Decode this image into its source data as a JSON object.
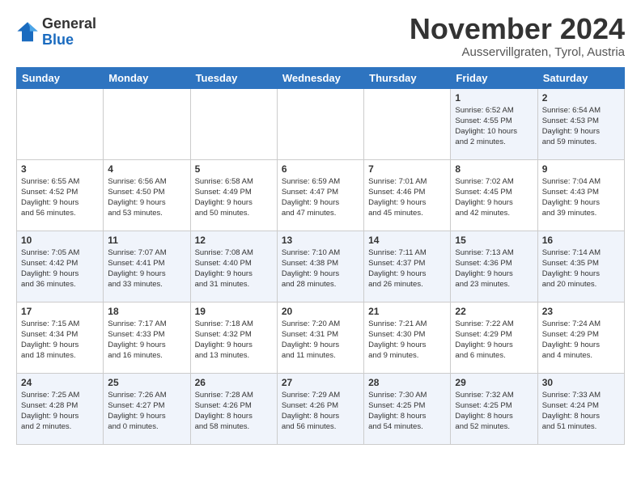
{
  "header": {
    "logo_general": "General",
    "logo_blue": "Blue",
    "month_title": "November 2024",
    "location": "Ausservillgraten, Tyrol, Austria"
  },
  "weekdays": [
    "Sunday",
    "Monday",
    "Tuesday",
    "Wednesday",
    "Thursday",
    "Friday",
    "Saturday"
  ],
  "weeks": [
    [
      {
        "day": "",
        "info": ""
      },
      {
        "day": "",
        "info": ""
      },
      {
        "day": "",
        "info": ""
      },
      {
        "day": "",
        "info": ""
      },
      {
        "day": "",
        "info": ""
      },
      {
        "day": "1",
        "info": "Sunrise: 6:52 AM\nSunset: 4:55 PM\nDaylight: 10 hours\nand 2 minutes."
      },
      {
        "day": "2",
        "info": "Sunrise: 6:54 AM\nSunset: 4:53 PM\nDaylight: 9 hours\nand 59 minutes."
      }
    ],
    [
      {
        "day": "3",
        "info": "Sunrise: 6:55 AM\nSunset: 4:52 PM\nDaylight: 9 hours\nand 56 minutes."
      },
      {
        "day": "4",
        "info": "Sunrise: 6:56 AM\nSunset: 4:50 PM\nDaylight: 9 hours\nand 53 minutes."
      },
      {
        "day": "5",
        "info": "Sunrise: 6:58 AM\nSunset: 4:49 PM\nDaylight: 9 hours\nand 50 minutes."
      },
      {
        "day": "6",
        "info": "Sunrise: 6:59 AM\nSunset: 4:47 PM\nDaylight: 9 hours\nand 47 minutes."
      },
      {
        "day": "7",
        "info": "Sunrise: 7:01 AM\nSunset: 4:46 PM\nDaylight: 9 hours\nand 45 minutes."
      },
      {
        "day": "8",
        "info": "Sunrise: 7:02 AM\nSunset: 4:45 PM\nDaylight: 9 hours\nand 42 minutes."
      },
      {
        "day": "9",
        "info": "Sunrise: 7:04 AM\nSunset: 4:43 PM\nDaylight: 9 hours\nand 39 minutes."
      }
    ],
    [
      {
        "day": "10",
        "info": "Sunrise: 7:05 AM\nSunset: 4:42 PM\nDaylight: 9 hours\nand 36 minutes."
      },
      {
        "day": "11",
        "info": "Sunrise: 7:07 AM\nSunset: 4:41 PM\nDaylight: 9 hours\nand 33 minutes."
      },
      {
        "day": "12",
        "info": "Sunrise: 7:08 AM\nSunset: 4:40 PM\nDaylight: 9 hours\nand 31 minutes."
      },
      {
        "day": "13",
        "info": "Sunrise: 7:10 AM\nSunset: 4:38 PM\nDaylight: 9 hours\nand 28 minutes."
      },
      {
        "day": "14",
        "info": "Sunrise: 7:11 AM\nSunset: 4:37 PM\nDaylight: 9 hours\nand 26 minutes."
      },
      {
        "day": "15",
        "info": "Sunrise: 7:13 AM\nSunset: 4:36 PM\nDaylight: 9 hours\nand 23 minutes."
      },
      {
        "day": "16",
        "info": "Sunrise: 7:14 AM\nSunset: 4:35 PM\nDaylight: 9 hours\nand 20 minutes."
      }
    ],
    [
      {
        "day": "17",
        "info": "Sunrise: 7:15 AM\nSunset: 4:34 PM\nDaylight: 9 hours\nand 18 minutes."
      },
      {
        "day": "18",
        "info": "Sunrise: 7:17 AM\nSunset: 4:33 PM\nDaylight: 9 hours\nand 16 minutes."
      },
      {
        "day": "19",
        "info": "Sunrise: 7:18 AM\nSunset: 4:32 PM\nDaylight: 9 hours\nand 13 minutes."
      },
      {
        "day": "20",
        "info": "Sunrise: 7:20 AM\nSunset: 4:31 PM\nDaylight: 9 hours\nand 11 minutes."
      },
      {
        "day": "21",
        "info": "Sunrise: 7:21 AM\nSunset: 4:30 PM\nDaylight: 9 hours\nand 9 minutes."
      },
      {
        "day": "22",
        "info": "Sunrise: 7:22 AM\nSunset: 4:29 PM\nDaylight: 9 hours\nand 6 minutes."
      },
      {
        "day": "23",
        "info": "Sunrise: 7:24 AM\nSunset: 4:29 PM\nDaylight: 9 hours\nand 4 minutes."
      }
    ],
    [
      {
        "day": "24",
        "info": "Sunrise: 7:25 AM\nSunset: 4:28 PM\nDaylight: 9 hours\nand 2 minutes."
      },
      {
        "day": "25",
        "info": "Sunrise: 7:26 AM\nSunset: 4:27 PM\nDaylight: 9 hours\nand 0 minutes."
      },
      {
        "day": "26",
        "info": "Sunrise: 7:28 AM\nSunset: 4:26 PM\nDaylight: 8 hours\nand 58 minutes."
      },
      {
        "day": "27",
        "info": "Sunrise: 7:29 AM\nSunset: 4:26 PM\nDaylight: 8 hours\nand 56 minutes."
      },
      {
        "day": "28",
        "info": "Sunrise: 7:30 AM\nSunset: 4:25 PM\nDaylight: 8 hours\nand 54 minutes."
      },
      {
        "day": "29",
        "info": "Sunrise: 7:32 AM\nSunset: 4:25 PM\nDaylight: 8 hours\nand 52 minutes."
      },
      {
        "day": "30",
        "info": "Sunrise: 7:33 AM\nSunset: 4:24 PM\nDaylight: 8 hours\nand 51 minutes."
      }
    ]
  ]
}
